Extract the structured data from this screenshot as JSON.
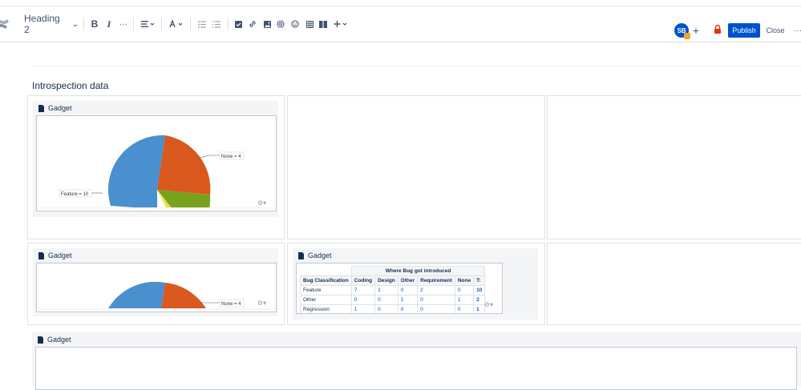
{
  "toolbar": {
    "heading_style": "Heading 2",
    "bold": "B",
    "italic": "I",
    "more": "···",
    "avatar_initials": "SB",
    "add_collaborator": "+",
    "publish_label": "Publish",
    "close_label": "Close",
    "more_actions": "···",
    "icons": [
      "bold-icon",
      "italic-icon",
      "more-formatting-icon",
      "alignment-icon",
      "text-color-icon",
      "bullet-list-icon",
      "numbered-list-icon",
      "action-item-icon",
      "link-icon",
      "image-icon",
      "mention-icon",
      "emoji-icon",
      "table-icon",
      "layouts-icon",
      "insert-icon",
      "lock-icon"
    ]
  },
  "page": {
    "heading": "Introspection data"
  },
  "gadgets": [
    {
      "title": "Gadget"
    },
    {
      "title": "Gadget"
    },
    {
      "title": "Gadget"
    },
    {
      "title": "Gadget"
    }
  ],
  "pie_labels": {
    "none": "None = 4",
    "feature": "Feature = 10",
    "none_small": "None = 4"
  },
  "colors": {
    "blue": "#4a90cf",
    "orange": "#d9581e",
    "green": "#7aa11c",
    "yellow": "#e6e64a",
    "brand": "#0052cc"
  },
  "bug_table": {
    "group_header": "Where Bug got introduced",
    "headers": [
      "Bug Classification",
      "Coding",
      "Design",
      "Other",
      "Requirement",
      "None",
      "T:"
    ],
    "rows": [
      [
        "Feature",
        "7",
        "1",
        "0",
        "2",
        "0",
        "10"
      ],
      [
        "Other",
        "0",
        "0",
        "1",
        "0",
        "1",
        "2"
      ],
      [
        "Regression",
        "1",
        "0",
        "0",
        "0",
        "0",
        "1"
      ]
    ]
  }
}
